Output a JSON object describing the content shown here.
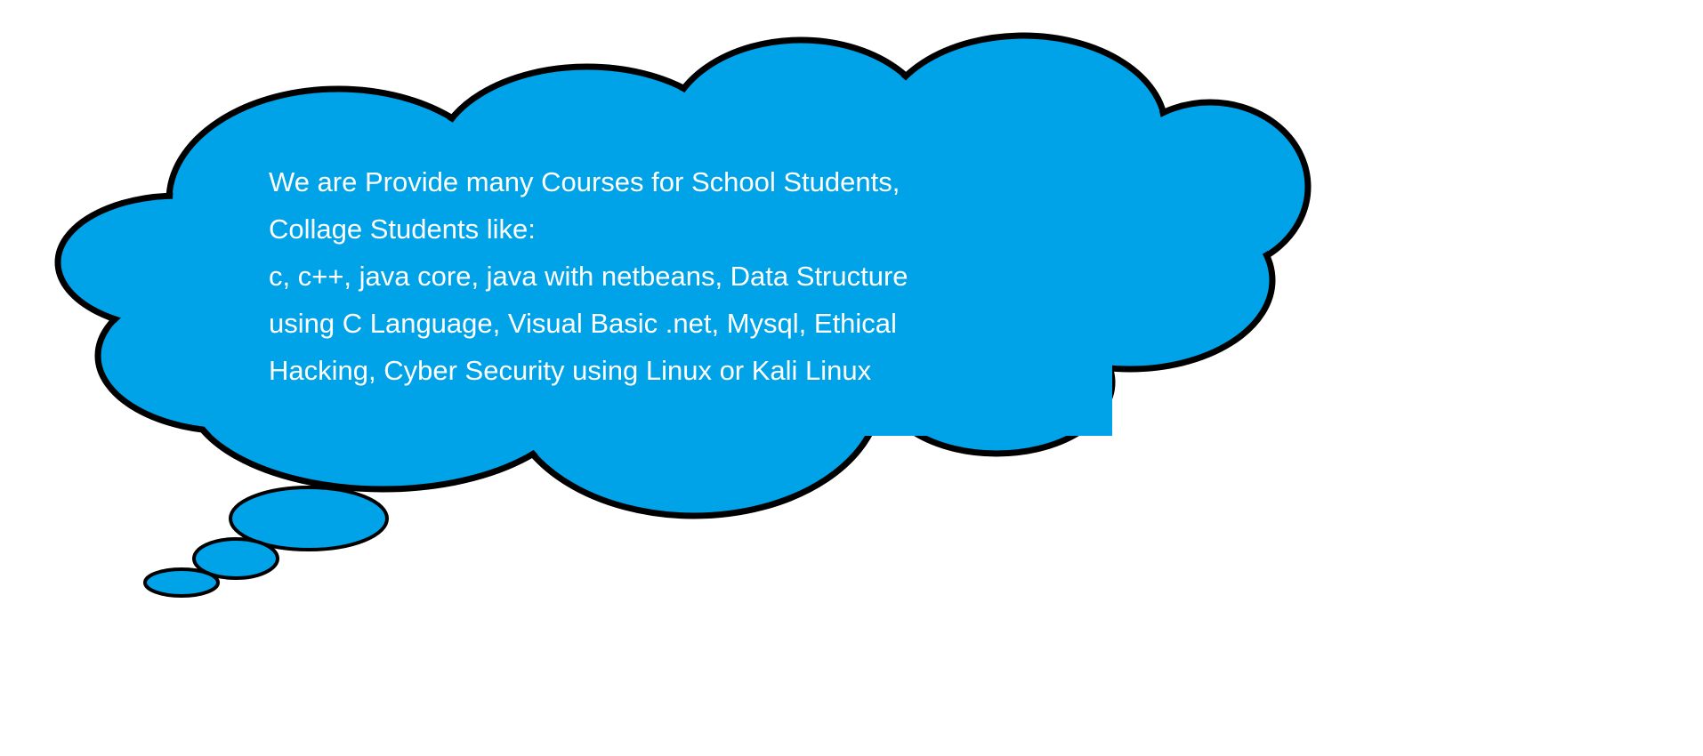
{
  "colors": {
    "cloud_fill": "#00A2E8",
    "outline": "#000000",
    "text": "#FFFFFF"
  },
  "message": {
    "lines": [
      "We are Provide many Courses for School Students,",
      "Collage Students like:",
      "c, c++, java core, java with netbeans, Data Structure",
      "using C Language, Visual Basic .net, Mysql, Ethical",
      "Hacking, Cyber Security using Linux or Kali Linux"
    ]
  }
}
